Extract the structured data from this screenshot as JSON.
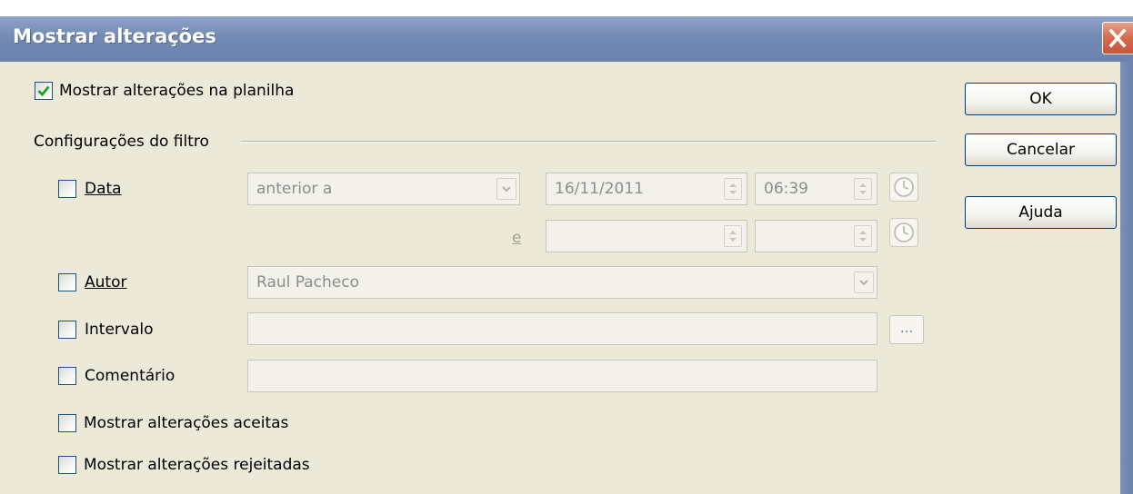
{
  "window": {
    "title": "Mostrar alterações",
    "close_icon": "close-icon"
  },
  "options": {
    "show_changes_label": "Mostrar alterações na planilha",
    "show_changes_checked": true,
    "filter_group_label": "Configurações do filtro",
    "show_accepted_label": "Mostrar alterações aceitas",
    "show_accepted_checked": false,
    "show_rejected_label": "Mostrar alterações rejeitadas",
    "show_rejected_checked": false
  },
  "filter": {
    "date": {
      "label": "Data",
      "checked": false,
      "condition": "anterior a",
      "date1": "16/11/2011",
      "time1": "06:39",
      "and_label": "e",
      "date2": "",
      "time2": ""
    },
    "author": {
      "label": "Autor",
      "checked": false,
      "value": "Raul Pacheco"
    },
    "range": {
      "label": "Intervalo",
      "checked": false,
      "value": "",
      "picker_label": "..."
    },
    "comment": {
      "label": "Comentário",
      "checked": false,
      "value": ""
    }
  },
  "buttons": {
    "ok": "OK",
    "cancel": "Cancelar",
    "help": "Ajuda"
  },
  "colors": {
    "titlebar": "#7a8fb8",
    "dialog_bg": "#ece9d8",
    "checkmark": "#21a121",
    "close_button": "#d46a4c"
  }
}
